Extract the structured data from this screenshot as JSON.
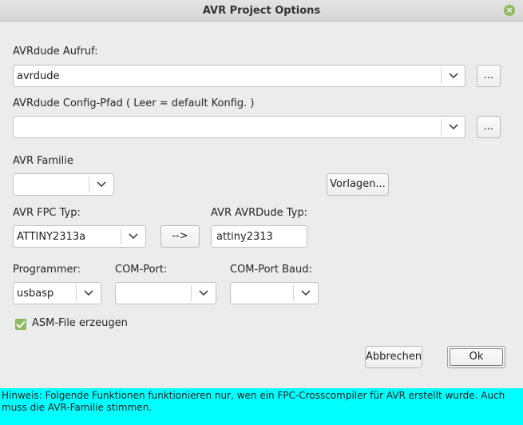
{
  "window": {
    "title": "AVR Project Options",
    "close_icon": "close-icon",
    "accent": "#8fb861"
  },
  "avrdude_call": {
    "label": "AVRdude Aufruf:",
    "value": "avrdude",
    "browse_label": "..."
  },
  "avrdude_config": {
    "label": "AVRdude Config-Pfad ( Leer = default Konfig. )",
    "value": "",
    "browse_label": "..."
  },
  "avr_family": {
    "label": "AVR Familie",
    "value": "",
    "templates_label": "Vorlagen..."
  },
  "fpc_type": {
    "label": "AVR FPC Typ:",
    "value": "ATTINY2313a"
  },
  "copy_button": {
    "label": "-->"
  },
  "avrdude_type": {
    "label": "AVR AVRDude Typ:",
    "value": "attiny2313"
  },
  "programmer": {
    "label": "Programmer:",
    "value": "usbasp"
  },
  "com_port": {
    "label": "COM-Port:",
    "value": ""
  },
  "com_baud": {
    "label": "COM-Port Baud:",
    "value": ""
  },
  "asm_file": {
    "label": "ASM-File erzeugen",
    "checked": true
  },
  "buttons": {
    "cancel": "Abbrechen",
    "ok": "Ok"
  },
  "hint": {
    "text": "Hinweis: Folgende Funktionen funktionieren nur, wen ein FPC-Crosscompiler für AVR erstellt wurde. Auch muss die AVR-Familie stimmen.",
    "color": "#00ffff"
  }
}
